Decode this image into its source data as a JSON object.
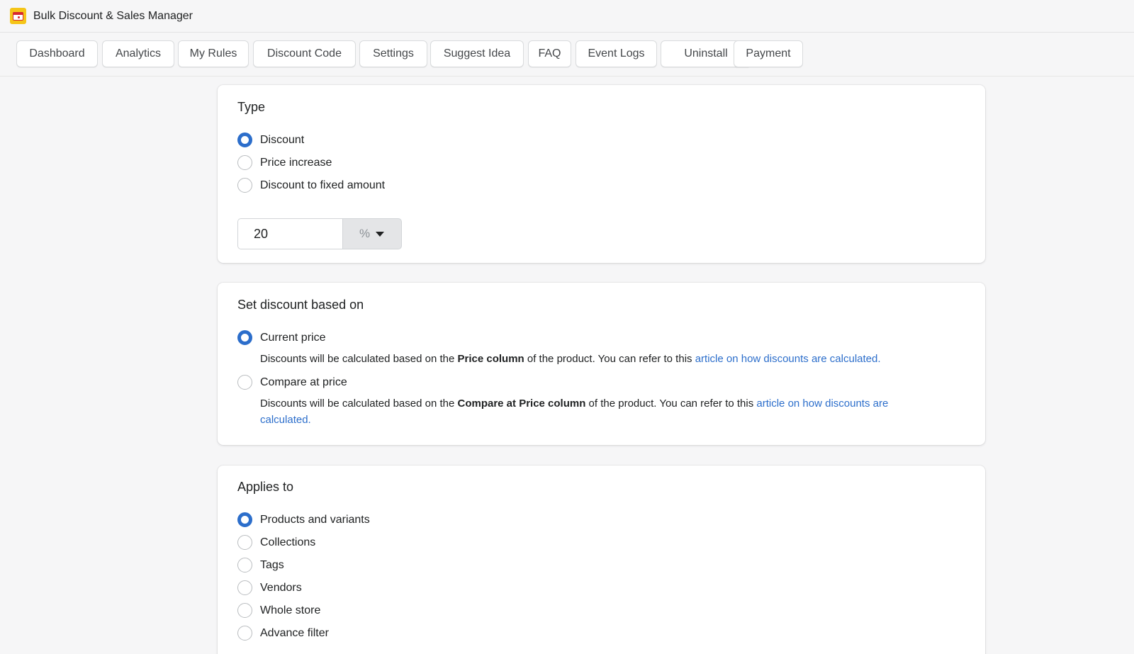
{
  "app": {
    "title": "Bulk Discount & Sales Manager",
    "icon": "calendar-icon",
    "icon_color": "#f5c518"
  },
  "nav": {
    "tabs": [
      {
        "label": "Dashboard"
      },
      {
        "label": "Analytics"
      },
      {
        "label": "My Rules"
      },
      {
        "label": "Discount Code"
      },
      {
        "label": "Settings"
      },
      {
        "label": "Suggest Idea"
      },
      {
        "label": "FAQ"
      },
      {
        "label": "Event Logs"
      },
      {
        "label": "Uninstall"
      },
      {
        "label": "Payment"
      }
    ]
  },
  "type_section": {
    "title": "Type",
    "options": [
      {
        "label": "Discount",
        "checked": true
      },
      {
        "label": "Price increase",
        "checked": false
      },
      {
        "label": "Discount to fixed amount",
        "checked": false
      }
    ],
    "amount_value": "20",
    "unit_value": "%"
  },
  "based_on_section": {
    "title": "Set discount based on",
    "options": [
      {
        "label": "Current price",
        "checked": true,
        "help_prefix": "Discounts will be calculated based on the ",
        "help_bold": "Price column",
        "help_middle": " of the product. You can refer to this ",
        "help_link": "article on how discounts are calculated."
      },
      {
        "label": "Compare at price",
        "checked": false,
        "help_prefix": "Discounts will be calculated based on the ",
        "help_bold": "Compare at Price column",
        "help_middle": " of the product. You can refer to this ",
        "help_link": "article on how discounts are calculated."
      }
    ]
  },
  "applies_section": {
    "title": "Applies to",
    "options": [
      {
        "label": "Products and variants",
        "checked": true
      },
      {
        "label": "Collections",
        "checked": false
      },
      {
        "label": "Tags",
        "checked": false
      },
      {
        "label": "Vendors",
        "checked": false
      },
      {
        "label": "Whole store",
        "checked": false
      },
      {
        "label": "Advance filter",
        "checked": false
      }
    ]
  },
  "colors": {
    "accent": "#2c6ecb",
    "background": "#f6f6f7",
    "card": "#ffffff"
  }
}
